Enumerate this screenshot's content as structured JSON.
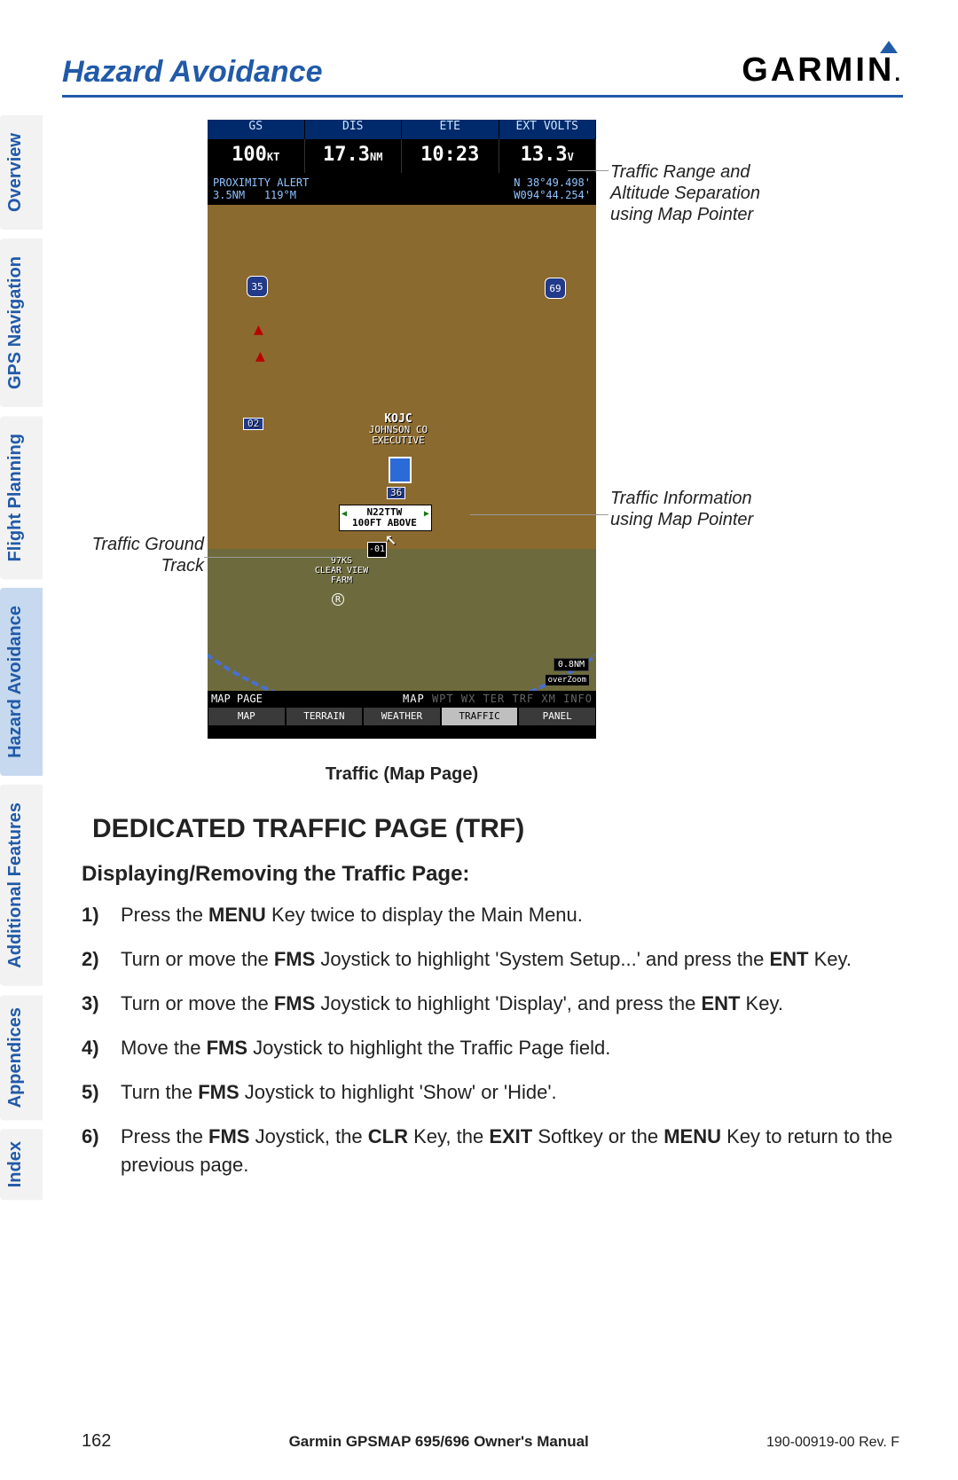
{
  "header": {
    "section": "Hazard Avoidance",
    "brand": "GARMIN"
  },
  "tabs": [
    "Overview",
    "GPS Navigation",
    "Flight Planning",
    "Hazard Avoidance",
    "Additional Features",
    "Appendices",
    "Index"
  ],
  "gps": {
    "top_labels": [
      "GS",
      "DIS",
      "ETE",
      "EXT VOLTS"
    ],
    "gs": "100",
    "gs_u": "KT",
    "dis": "17.3",
    "dis_u": "NM",
    "ete": "10:23",
    "volts": "13.3",
    "volts_u": "V",
    "prox_title": "PROXIMITY ALERT",
    "prox_dist": "3.5NM",
    "prox_brg": "119°M",
    "lat": "N 38°49.498'",
    "lon": "W094°44.254'",
    "hwy35": "35",
    "hwy69": "69",
    "hdg_02": "02",
    "airport_id": "KOJC",
    "airport_l1": "JOHNSON CO",
    "airport_l2": "EXECUTIVE",
    "rwy": "36",
    "ptr_l1": "N22TTW",
    "ptr_l2": "100FT ABOVE",
    "target_alt": "-01",
    "farm_id": "97KS",
    "farm_l1": "CLEAR VIEW",
    "farm_l2": "FARM",
    "scale": "0.8NM",
    "overzoom": "overZoom",
    "footer_page": "MAP PAGE",
    "idx_on": [
      "MAP"
    ],
    "idx_off": [
      "WPT",
      "WX",
      "TER",
      "TRF",
      "XM",
      "INFO"
    ],
    "softkeys": [
      "MAP",
      "TERRAIN",
      "WEATHER",
      "TRAFFIC",
      "PANEL"
    ],
    "softkey_active": 3
  },
  "callouts": {
    "range": "Traffic Range and Altitude Separation using Map Pointer",
    "info": "Traffic Information using Map Pointer",
    "ground": "Traffic Ground Track"
  },
  "caption": "Traffic (Map Page)",
  "section_title": "DEDICATED TRAFFIC PAGE (TRF)",
  "sub_title": "Displaying/Removing the Traffic Page:",
  "steps": [
    {
      "n": "1)",
      "pre": "Press the ",
      "b1": "MENU",
      "post": " Key twice to display the Main Menu."
    },
    {
      "n": "2)",
      "pre": "Turn or move the ",
      "b1": "FMS",
      "mid": " Joystick to highlight 'System Setup...' and press the ",
      "b2": "ENT",
      "post": " Key."
    },
    {
      "n": "3)",
      "pre": "Turn or move the ",
      "b1": "FMS",
      "mid": " Joystick to highlight 'Display', and press the ",
      "b2": "ENT",
      "post": " Key."
    },
    {
      "n": "4)",
      "pre": "Move the ",
      "b1": "FMS",
      "post": " Joystick to highlight the Traffic Page field."
    },
    {
      "n": "5)",
      "pre": "Turn the ",
      "b1": "FMS",
      "post": " Joystick to highlight 'Show' or 'Hide'."
    },
    {
      "n": "6)",
      "pre": "Press the ",
      "b1": "FMS",
      "mid": " Joystick, the ",
      "b2": "CLR",
      "mid2": " Key, the ",
      "b3": "EXIT",
      "mid3": " Softkey or the ",
      "b4": "MENU",
      "post": " Key to return to the previous page."
    }
  ],
  "footer": {
    "page": "162",
    "title": "Garmin GPSMAP 695/696 Owner's Manual",
    "doc": "190-00919-00  Rev. F"
  }
}
